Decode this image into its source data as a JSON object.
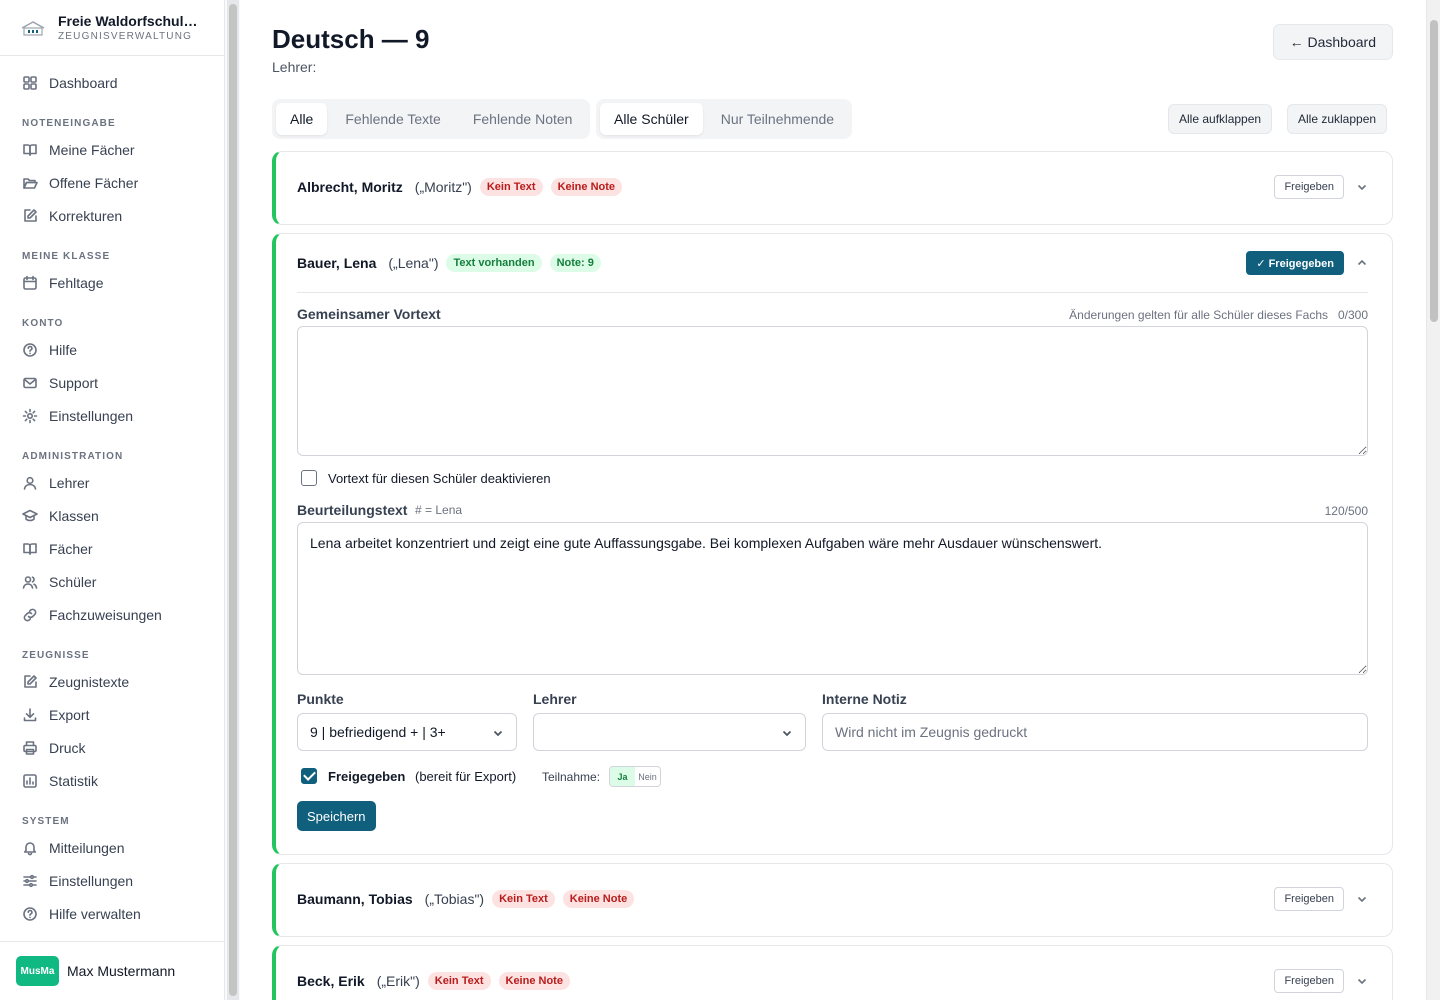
{
  "brand": {
    "name": "Freie Waldorfschul…",
    "subtitle": "ZEUGNISVERWALTUNG"
  },
  "sidebar": {
    "dashboard": "Dashboard",
    "sections": {
      "noteneingabe": "NOTENEINGABE",
      "meine_klasse": "MEINE KLASSE",
      "konto": "KONTO",
      "administration": "ADMINISTRATION",
      "zeugnisse": "ZEUGNISSE",
      "system": "SYSTEM"
    },
    "items": {
      "meine_faecher": "Meine Fächer",
      "offene_faecher": "Offene Fächer",
      "korrekturen": "Korrekturen",
      "fehltage": "Fehltage",
      "hilfe": "Hilfe",
      "support": "Support",
      "einstellungen": "Einstellungen",
      "lehrer": "Lehrer",
      "klassen": "Klassen",
      "faecher": "Fächer",
      "schueler": "Schüler",
      "fachzuweisungen": "Fachzuweisungen",
      "zeugnistexte": "Zeugnistexte",
      "export": "Export",
      "druck": "Druck",
      "statistik": "Statistik",
      "mitteilungen": "Mitteilungen",
      "sys_einstellungen": "Einstellungen",
      "hilfe_verwalten": "Hilfe verwalten"
    }
  },
  "user": {
    "initials": "MusMa",
    "name": "Max Mustermann"
  },
  "header": {
    "title": "Deutsch — 9",
    "teacher_label": "Lehrer:",
    "dashboard_button": "← Dashboard"
  },
  "filters": {
    "text_filter": [
      "Alle",
      "Fehlende Texte",
      "Fehlende Noten"
    ],
    "student_filter": [
      "Alle Schüler",
      "Nur Teilnehmende"
    ],
    "expand_all": "Alle aufklappen",
    "collapse_all": "Alle zuklappen"
  },
  "students": [
    {
      "name": "Albrecht, Moritz",
      "nick": "(„Moritz\")",
      "badge1": "Kein Text",
      "badge2": "Keine Note",
      "release": "Freigeben"
    },
    {
      "name": "Bauer, Lena",
      "nick": "(„Lena\")",
      "badge1": "Text vorhanden",
      "badge2": "Note: 9",
      "release": "✓ Freigegeben"
    },
    {
      "name": "Baumann, Tobias",
      "nick": "(„Tobias\")",
      "badge1": "Kein Text",
      "badge2": "Keine Note",
      "release": "Freigeben"
    },
    {
      "name": "Beck, Erik",
      "nick": "(„Erik\")",
      "badge1": "Kein Text",
      "badge2": "Keine Note",
      "release": "Freigeben"
    }
  ],
  "detail": {
    "vortext_label": "Gemeinsamer Vortext",
    "vortext_hint": "Änderungen gelten für alle Schüler dieses Fachs",
    "vortext_count": "0/300",
    "vortext_value": "",
    "deactivate_label": "Vortext für diesen Schüler deaktivieren",
    "beurteilung_label": "Beurteilungstext",
    "beurteilung_hint": "# = Lena",
    "beurteilung_count": "120/500",
    "beurteilung_value": "Lena arbeitet konzentriert und zeigt eine gute Auffassungsgabe. Bei komplexen Aufgaben wäre mehr Ausdauer wünschenswert.",
    "punkte_label": "Punkte",
    "punkte_value": "9 | befriedigend + | 3+",
    "lehrer_label": "Lehrer",
    "lehrer_value": "",
    "notiz_label": "Interne Notiz",
    "notiz_placeholder": "Wird nicht im Zeugnis gedruckt",
    "freigegeben_label": "Freigegeben",
    "freigegeben_hint": "(bereit für Export)",
    "teilnahme_label": "Teilnahme:",
    "teilnahme_yes": "Ja",
    "teilnahme_no": "Nein",
    "save_button": "Speichern"
  }
}
